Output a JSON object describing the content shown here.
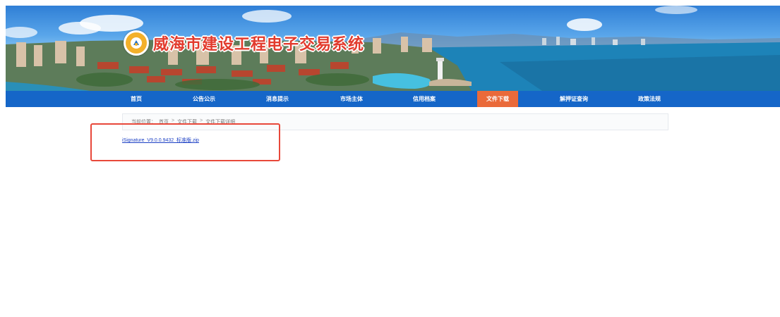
{
  "site": {
    "title": "威海市建设工程电子交易系统"
  },
  "nav": {
    "items": [
      {
        "label": "首页"
      },
      {
        "label": "公告公示"
      },
      {
        "label": "消息提示"
      },
      {
        "label": "市场主体"
      },
      {
        "label": "信用档案"
      },
      {
        "label": "文件下载"
      },
      {
        "label": "解押证查询"
      },
      {
        "label": "政策法规"
      }
    ],
    "active": "文件下载",
    "active_color": "#ea6a3a",
    "bar_color": "#1566c8"
  },
  "breadcrumb": {
    "prefix": "当前位置：",
    "items": [
      "首页",
      "文件下载",
      "文件下载详细"
    ],
    "separator": ">"
  },
  "download": {
    "file_name": "iSignature_V9.0.0.9432_标准版.zip"
  },
  "annotation": {
    "color": "#e8483a"
  },
  "icons": {
    "logo": "logo-emblem-icon"
  }
}
